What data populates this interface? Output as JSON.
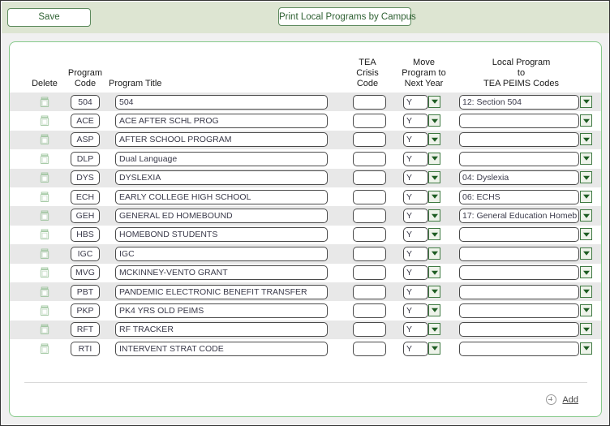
{
  "toolbar": {
    "save_label": "Save",
    "print_label": "Print Local Programs by Campus"
  },
  "grid": {
    "headers": {
      "delete": "Delete",
      "program_code_l1": "Program",
      "program_code_l2": "Code",
      "program_title": "Program Title",
      "tea_crisis_l1": "TEA",
      "tea_crisis_l2": "Crisis",
      "tea_crisis_l3": "Code",
      "move_l1": "Move",
      "move_l2": "Program to",
      "move_l3": "Next Year",
      "local_l1": "Local Program",
      "local_l2": "to",
      "local_l3": "TEA PEIMS Codes"
    },
    "delete_icon": "trash-icon",
    "dropdown_icon": "chevron-down-icon",
    "rows": [
      {
        "code": "504",
        "title": "504",
        "crisis": "",
        "move": "Y",
        "peims": "12: Section 504"
      },
      {
        "code": "ACE",
        "title": "ACE AFTER SCHL PROG",
        "crisis": "",
        "move": "Y",
        "peims": ""
      },
      {
        "code": "ASP",
        "title": "AFTER SCHOOL PROGRAM",
        "crisis": "",
        "move": "Y",
        "peims": ""
      },
      {
        "code": "DLP",
        "title": "Dual Language",
        "crisis": "",
        "move": "Y",
        "peims": ""
      },
      {
        "code": "DYS",
        "title": "DYSLEXIA",
        "crisis": "",
        "move": "Y",
        "peims": "04: Dyslexia"
      },
      {
        "code": "ECH",
        "title": "EARLY COLLEGE HIGH SCHOOL",
        "crisis": "",
        "move": "Y",
        "peims": "06: ECHS"
      },
      {
        "code": "GEH",
        "title": "GENERAL ED HOMEBOUND",
        "crisis": "",
        "move": "Y",
        "peims": "17: General Education Homeb"
      },
      {
        "code": "HBS",
        "title": "HOMEBOND STUDENTS",
        "crisis": "",
        "move": "Y",
        "peims": ""
      },
      {
        "code": "IGC",
        "title": "IGC",
        "crisis": "",
        "move": "Y",
        "peims": ""
      },
      {
        "code": "MVG",
        "title": "MCKINNEY-VENTO GRANT",
        "crisis": "",
        "move": "Y",
        "peims": ""
      },
      {
        "code": "PBT",
        "title": "PANDEMIC ELECTRONIC BENEFIT TRANSFER",
        "crisis": "",
        "move": "Y",
        "peims": ""
      },
      {
        "code": "PKP",
        "title": "PK4 YRS OLD PEIMS",
        "crisis": "",
        "move": "Y",
        "peims": ""
      },
      {
        "code": "RFT",
        "title": "RF TRACKER",
        "crisis": "",
        "move": "Y",
        "peims": ""
      },
      {
        "code": "RTI",
        "title": "INTERVENT STRAT CODE",
        "crisis": "",
        "move": "Y",
        "peims": ""
      }
    ]
  },
  "footer": {
    "add_label": "Add",
    "add_icon": "plus-circle-icon"
  },
  "colors": {
    "toolbar_bg": "#dde5d2",
    "panel_border": "#86c98a",
    "button_border": "#5d8a5d",
    "button_text": "#2f6133",
    "row_stripe": "#e8e8e8",
    "dropdown_arrow": "#1d5c22"
  }
}
